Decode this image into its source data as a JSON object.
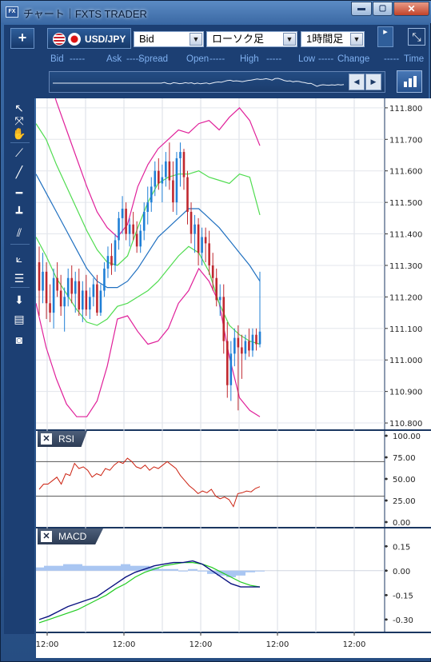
{
  "window": {
    "title": "チャート｜FXTS TRADER",
    "app_icon": "FX",
    "minimize_glyph": "▬",
    "maximize_glyph": "▢",
    "close_glyph": "✕"
  },
  "toolbar": {
    "plus_glyph": "+",
    "symbol": "USD/JPY",
    "price_type": "Bid",
    "chart_type": "ローソク足",
    "timeframe": "1時間足",
    "expand_glyph": "⤡",
    "grip_glyph": "▸"
  },
  "quote_row": [
    {
      "key": "bid",
      "label": "Bid",
      "value": "-----"
    },
    {
      "key": "ask",
      "label": "Ask",
      "value": "-----"
    },
    {
      "key": "spread",
      "label": "Spread",
      "value": ""
    },
    {
      "key": "open",
      "label": "Open",
      "value": "-----"
    },
    {
      "key": "high",
      "label": "High",
      "value": "-----"
    },
    {
      "key": "low",
      "label": "Low",
      "value": "-----"
    },
    {
      "key": "change",
      "label": "Change",
      "value": "-----"
    },
    {
      "key": "time",
      "label": "Time",
      "value": ""
    }
  ],
  "sparkline": {
    "prev_glyph": "◀",
    "next_glyph": "▶"
  },
  "tools": [
    {
      "name": "cursor-arrow-icon",
      "glyph": "↖"
    },
    {
      "name": "crosshair-cursor-icon",
      "glyph": "⤧"
    },
    {
      "name": "hand-pan-icon",
      "glyph": "✋"
    },
    {
      "name": "pin-line-icon",
      "glyph": "⟋"
    },
    {
      "name": "trend-line-icon",
      "glyph": "╱"
    },
    {
      "name": "horizontal-line-icon",
      "glyph": "━"
    },
    {
      "name": "vertical-line-icon",
      "glyph": "┻"
    },
    {
      "name": "parallel-channel-icon",
      "glyph": "⫽"
    },
    {
      "name": "fibonacci-fan-icon",
      "glyph": "⟀"
    },
    {
      "name": "fibonacci-retracement-icon",
      "glyph": "☰"
    },
    {
      "name": "scroll-down-icon",
      "glyph": "⬇"
    },
    {
      "name": "list-icon",
      "glyph": "▤"
    },
    {
      "name": "screenshot-camera-icon",
      "glyph": "◙"
    }
  ],
  "panels": {
    "rsi_label": "RSI",
    "macd_label": "MACD",
    "close_glyph": "✕"
  },
  "colors": {
    "up_candle": "#1f7fd6",
    "down_candle": "#c0282f",
    "bollinger_outer": "#e0209a",
    "bollinger_inner": "#50dc50",
    "moving_average": "#2070c0",
    "rsi_line": "#cc2211",
    "macd_line": "#0a1280",
    "signal_line": "#22cc22",
    "histogram": "#a9c6f2"
  },
  "chart_data": [
    {
      "type": "candlestick",
      "y_axis_ticks": [
        "111.800",
        "111.700",
        "111.600",
        "111.500",
        "111.400",
        "111.300",
        "111.200",
        "111.100",
        "111.000",
        "110.900",
        "110.800"
      ],
      "ylim": [
        110.79,
        111.82
      ],
      "x_tick_labels": [
        "12:00",
        "12:00",
        "12:00",
        "12:00",
        "12:00"
      ],
      "candles": [
        [
          111.31,
          111.36,
          111.14,
          111.22
        ],
        [
          111.22,
          111.34,
          111.18,
          111.28
        ],
        [
          111.28,
          111.31,
          111.13,
          111.18
        ],
        [
          111.18,
          111.24,
          111.12,
          111.15
        ],
        [
          111.15,
          111.29,
          111.1,
          111.26
        ],
        [
          111.26,
          111.31,
          111.2,
          111.22
        ],
        [
          111.22,
          111.27,
          111.14,
          111.17
        ],
        [
          111.17,
          111.23,
          111.09,
          111.2
        ],
        [
          111.2,
          111.29,
          111.17,
          111.26
        ],
        [
          111.26,
          111.3,
          111.18,
          111.21
        ],
        [
          111.21,
          111.28,
          111.15,
          111.25
        ],
        [
          111.25,
          111.29,
          111.14,
          111.16
        ],
        [
          111.16,
          111.25,
          111.12,
          111.22
        ],
        [
          111.22,
          111.27,
          111.14,
          111.16
        ],
        [
          111.16,
          111.23,
          111.13,
          111.2
        ],
        [
          111.2,
          111.26,
          111.17,
          111.24
        ],
        [
          111.24,
          111.27,
          111.14,
          111.15
        ],
        [
          111.15,
          111.24,
          111.14,
          111.22
        ],
        [
          111.22,
          111.31,
          111.2,
          111.29
        ],
        [
          111.29,
          111.36,
          111.26,
          111.33
        ],
        [
          111.33,
          111.37,
          111.27,
          111.3
        ],
        [
          111.3,
          111.4,
          111.28,
          111.38
        ],
        [
          111.38,
          111.47,
          111.35,
          111.45
        ],
        [
          111.45,
          111.52,
          111.4,
          111.48
        ],
        [
          111.48,
          111.5,
          111.38,
          111.4
        ],
        [
          111.4,
          111.45,
          111.36,
          111.43
        ],
        [
          111.43,
          111.47,
          111.38,
          111.4
        ],
        [
          111.4,
          111.44,
          111.34,
          111.36
        ],
        [
          111.36,
          111.43,
          111.34,
          111.41
        ],
        [
          111.41,
          111.5,
          111.38,
          111.47
        ],
        [
          111.47,
          111.55,
          111.43,
          111.5
        ],
        [
          111.5,
          111.58,
          111.47,
          111.55
        ],
        [
          111.55,
          111.63,
          111.52,
          111.6
        ],
        [
          111.6,
          111.64,
          111.54,
          111.56
        ],
        [
          111.56,
          111.62,
          111.5,
          111.58
        ],
        [
          111.58,
          111.66,
          111.55,
          111.63
        ],
        [
          111.63,
          111.69,
          111.54,
          111.57
        ],
        [
          111.57,
          111.63,
          111.47,
          111.5
        ],
        [
          111.5,
          111.66,
          111.46,
          111.64
        ],
        [
          111.64,
          111.69,
          111.55,
          111.66
        ],
        [
          111.66,
          111.67,
          111.54,
          111.58
        ],
        [
          111.58,
          111.6,
          111.43,
          111.47
        ],
        [
          111.47,
          111.5,
          111.37,
          111.4
        ],
        [
          111.4,
          111.46,
          111.34,
          111.43
        ],
        [
          111.43,
          111.45,
          111.3,
          111.34
        ],
        [
          111.34,
          111.42,
          111.3,
          111.39
        ],
        [
          111.39,
          111.42,
          111.31,
          111.37
        ],
        [
          111.37,
          111.41,
          111.27,
          111.3
        ],
        [
          111.3,
          111.34,
          111.22,
          111.26
        ],
        [
          111.26,
          111.29,
          111.17,
          111.19
        ],
        [
          111.19,
          111.24,
          111.14,
          111.2
        ],
        [
          111.2,
          111.24,
          111.02,
          111.06
        ],
        [
          111.06,
          111.12,
          110.88,
          110.92
        ],
        [
          110.92,
          111.06,
          110.87,
          111.02
        ],
        [
          111.02,
          111.1,
          110.98,
          111.07
        ],
        [
          111.07,
          111.11,
          110.84,
          111.04
        ],
        [
          111.04,
          111.08,
          110.94,
          111.02
        ],
        [
          111.02,
          111.08,
          111.0,
          111.06
        ],
        [
          111.06,
          111.1,
          111.01,
          111.03
        ],
        [
          111.03,
          111.1,
          111.01,
          111.08
        ],
        [
          111.08,
          111.1,
          111.03,
          111.05
        ],
        [
          111.05,
          111.28,
          111.04,
          111.09
        ]
      ],
      "bollinger": {
        "upper": [
          111.98,
          111.93,
          111.82,
          111.73,
          111.64,
          111.55,
          111.47,
          111.42,
          111.39,
          111.43,
          111.55,
          111.62,
          111.67,
          111.7,
          111.73,
          111.72,
          111.75,
          111.76,
          111.73,
          111.77,
          111.8,
          111.76,
          111.68
        ],
        "upper_inner": [
          111.75,
          111.7,
          111.62,
          111.55,
          111.48,
          111.41,
          111.35,
          111.31,
          111.3,
          111.33,
          111.42,
          111.5,
          111.56,
          111.58,
          111.59,
          111.59,
          111.6,
          111.58,
          111.57,
          111.56,
          111.59,
          111.58,
          111.46
        ],
        "middle": [
          111.59,
          111.53,
          111.47,
          111.41,
          111.35,
          111.29,
          111.25,
          111.23,
          111.23,
          111.25,
          111.29,
          111.34,
          111.39,
          111.42,
          111.45,
          111.48,
          111.48,
          111.45,
          111.42,
          111.38,
          111.34,
          111.3,
          111.25
        ],
        "lower_inner": [
          111.39,
          111.33,
          111.26,
          111.21,
          111.16,
          111.12,
          111.11,
          111.13,
          111.17,
          111.18,
          111.2,
          111.22,
          111.25,
          111.29,
          111.33,
          111.36,
          111.34,
          111.28,
          111.18,
          111.11,
          111.08,
          111.06,
          111.05
        ],
        "lower": [
          111.18,
          111.04,
          110.94,
          110.86,
          110.82,
          110.82,
          110.87,
          110.98,
          111.13,
          111.14,
          111.09,
          111.05,
          111.06,
          111.1,
          111.18,
          111.22,
          111.29,
          111.25,
          111.18,
          111.01,
          110.88,
          110.84,
          110.82
        ]
      }
    },
    {
      "type": "line",
      "name": "RSI",
      "y_axis_ticks": [
        "100.00",
        "75.00",
        "50.00",
        "25.00",
        "0.00"
      ],
      "ylim": [
        0,
        100
      ],
      "levels": [
        70,
        30
      ],
      "values": [
        38,
        44,
        44,
        48,
        52,
        44,
        56,
        54,
        68,
        62,
        64,
        60,
        52,
        56,
        54,
        62,
        60,
        66,
        70,
        68,
        74,
        70,
        64,
        62,
        66,
        60,
        64,
        62,
        66,
        70,
        66,
        62,
        54,
        48,
        42,
        38,
        33,
        36,
        34,
        38,
        30,
        27,
        29,
        26,
        18,
        33,
        34,
        36,
        35,
        39,
        41
      ]
    },
    {
      "type": "bar+line",
      "name": "MACD",
      "y_axis_ticks": [
        "0.15",
        "0.00",
        "-0.15",
        "-0.30"
      ],
      "ylim": [
        -0.34,
        0.22
      ],
      "macd": [
        -0.3,
        -0.28,
        -0.25,
        -0.22,
        -0.2,
        -0.18,
        -0.16,
        -0.12,
        -0.08,
        -0.04,
        -0.01,
        0.01,
        0.03,
        0.04,
        0.05,
        0.05,
        0.06,
        0.04,
        0.0,
        -0.04,
        -0.08,
        -0.1,
        -0.1,
        -0.1
      ],
      "signal": [
        -0.32,
        -0.3,
        -0.28,
        -0.26,
        -0.24,
        -0.21,
        -0.18,
        -0.15,
        -0.11,
        -0.08,
        -0.04,
        -0.01,
        0.01,
        0.03,
        0.04,
        0.05,
        0.05,
        0.04,
        0.02,
        -0.01,
        -0.04,
        -0.07,
        -0.09,
        -0.1
      ],
      "histogram": [
        0.02,
        0.03,
        0.03,
        0.04,
        0.04,
        0.03,
        0.03,
        0.03,
        0.03,
        0.04,
        0.03,
        0.03,
        0.02,
        0.01,
        0.01,
        0.0,
        0.01,
        0.0,
        -0.02,
        -0.03,
        -0.04,
        -0.03,
        -0.01,
        0.0
      ]
    }
  ]
}
